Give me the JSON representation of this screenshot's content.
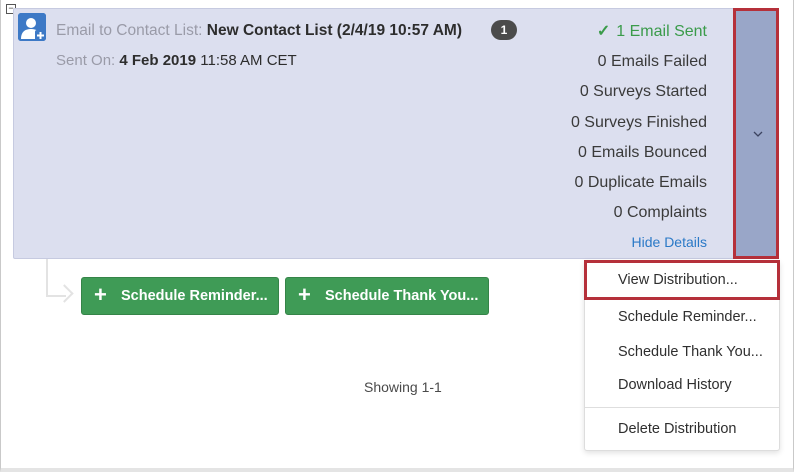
{
  "distribution": {
    "title_label": "Email to Contact List:",
    "title_value": "New Contact List (2/4/19 10:57 AM)",
    "count_badge": "1",
    "sent_label": "Sent On:",
    "sent_date": "4 Feb 2019",
    "sent_time": "11:58 AM CET"
  },
  "stats": [
    {
      "label": "1 Email Sent",
      "status": "success"
    },
    {
      "label": "0 Emails Failed"
    },
    {
      "label": "0 Surveys Started"
    },
    {
      "label": "0 Surveys Finished"
    },
    {
      "label": "0 Emails Bounced"
    },
    {
      "label": "0 Duplicate Emails"
    },
    {
      "label": "0 Complaints"
    }
  ],
  "hide_details": "Hide Details",
  "buttons": {
    "schedule_reminder": "Schedule Reminder...",
    "schedule_thank_you": "Schedule Thank You..."
  },
  "footer": {
    "showing": "Showing 1-1"
  },
  "menu": {
    "items": [
      "View Distribution...",
      "Schedule Reminder...",
      "Schedule Thank You...",
      "Download History",
      "Delete Distribution"
    ],
    "selected_index": 0
  },
  "colors": {
    "card_background": "#dcdfef",
    "expand_column": "#99a6c8",
    "highlight_border": "#b5303a",
    "success_green": "#3a9b4a",
    "button_green": "#3f9b56",
    "link_blue": "#2a79c7",
    "avatar_blue": "#3d79c6"
  },
  "icons": {
    "avatar": "contact-add-icon",
    "check": "check-icon",
    "expand": "chevron-down-icon",
    "plus": "plus-icon",
    "collapse": "collapse-box-icon"
  }
}
